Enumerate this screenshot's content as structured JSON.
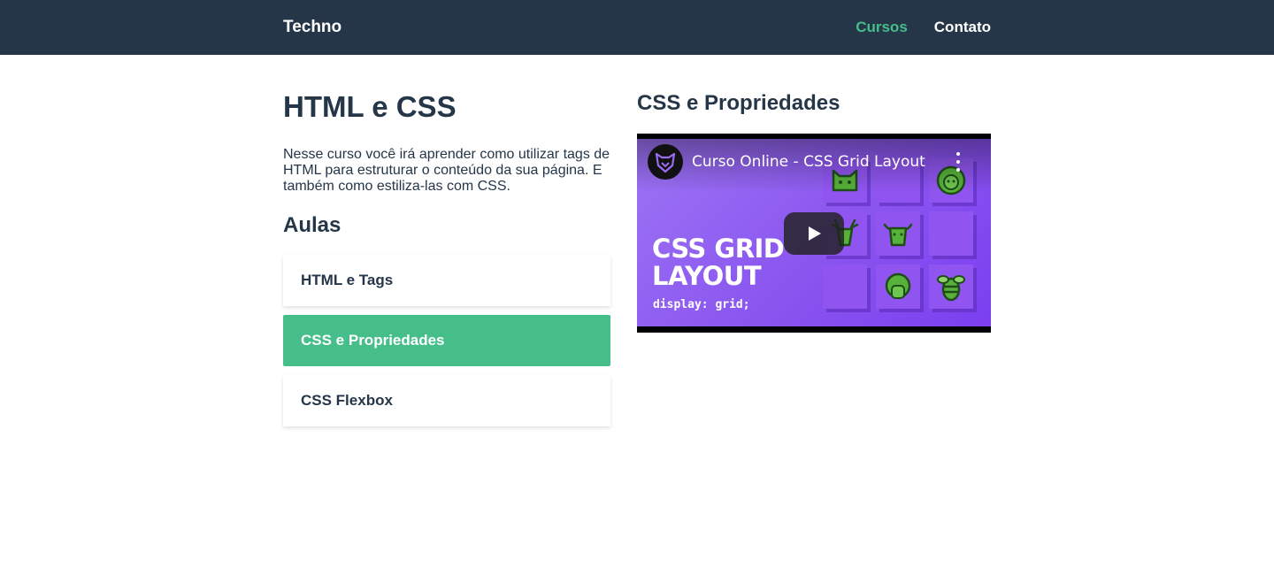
{
  "header": {
    "logo": "Techno",
    "nav": [
      {
        "label": "Cursos",
        "active": true
      },
      {
        "label": "Contato",
        "active": false
      }
    ]
  },
  "course": {
    "title": "HTML e CSS",
    "description": "Nesse curso você irá aprender como utilizar tags de HTML para estruturar o conteúdo da sua página. E também como estiliza-las com CSS.",
    "lessons_heading": "Aulas",
    "lessons": [
      {
        "label": "HTML e Tags",
        "active": false
      },
      {
        "label": "CSS e Propriedades",
        "active": true
      },
      {
        "label": "CSS Flexbox",
        "active": false
      }
    ]
  },
  "video": {
    "section_title": "CSS e Propriedades",
    "name": "Curso Online - CSS Grid Layout",
    "thumbnail_title": "CSS GRID LAYOUT",
    "thumbnail_code": "display: grid;",
    "play_icon": "play-icon",
    "more_icon": "more-vertical-icon"
  },
  "colors": {
    "header_bg": "#253648",
    "accent": "#45be8a",
    "text": "#253648",
    "thumb_purple": "#8a55ef"
  }
}
